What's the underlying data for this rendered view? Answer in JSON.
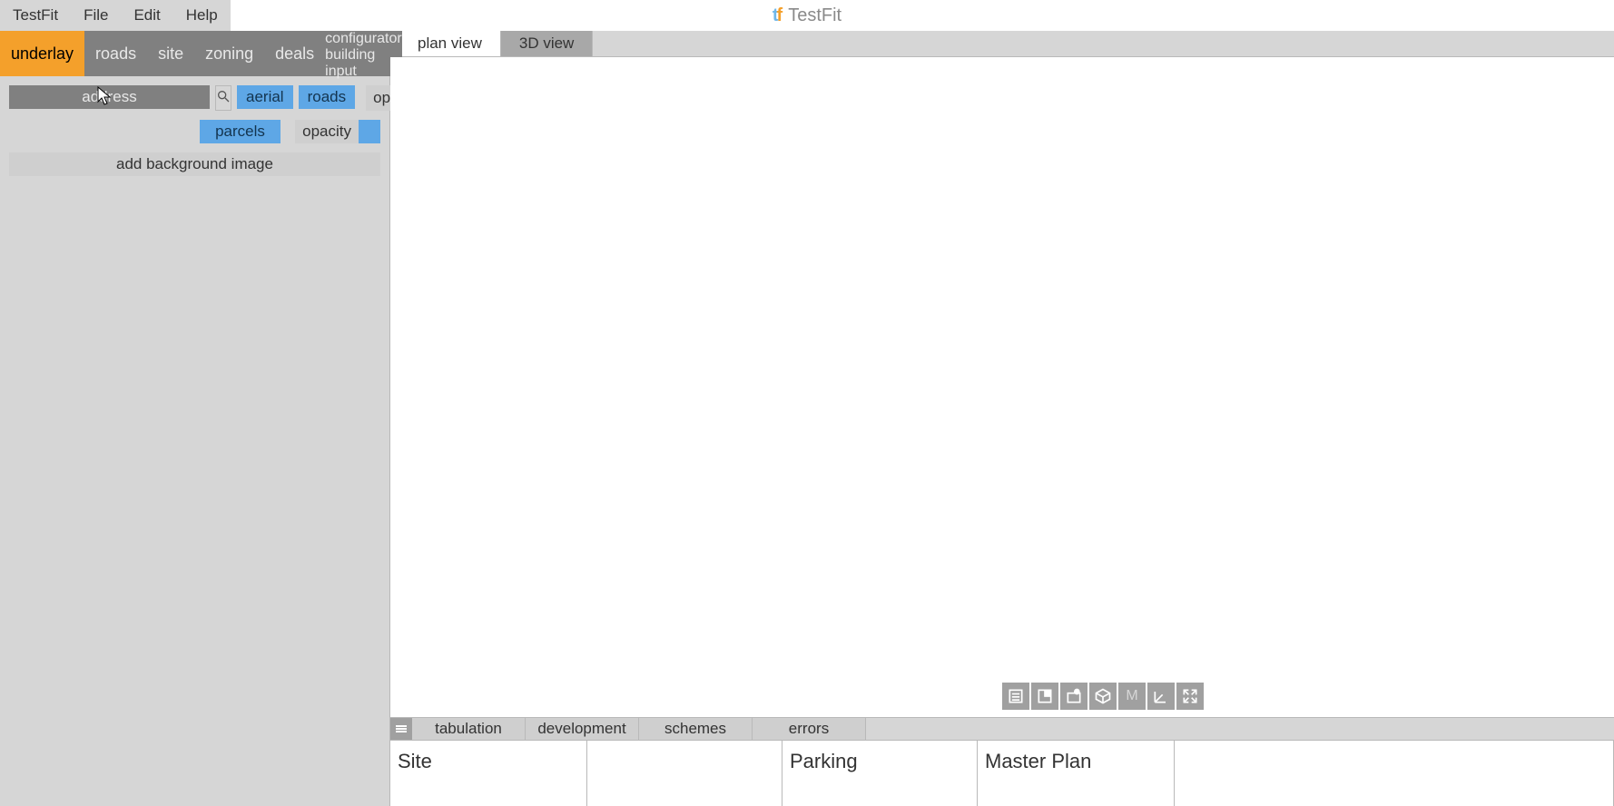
{
  "menu": {
    "app": "TestFit",
    "file": "File",
    "edit": "Edit",
    "help": "Help"
  },
  "titlebar": {
    "name": "TestFit"
  },
  "sidebar": {
    "tabs": {
      "underlay": "underlay",
      "roads": "roads",
      "site": "site",
      "zoning": "zoning",
      "deals": "deals"
    },
    "rightTabs": {
      "configurator": "configurator",
      "building_input": "building input"
    },
    "address_placeholder": "address",
    "chips": {
      "aerial": "aerial",
      "roads": "roads",
      "parcels": "parcels"
    },
    "opacity_label": "opacity",
    "add_bg": "add background image"
  },
  "viewport": {
    "plan": "plan view",
    "three_d": "3D view"
  },
  "tools": {
    "t1": "list-icon",
    "t2": "sheet-icon",
    "t3": "layer-dot-icon",
    "t4": "cube-icon",
    "t5": "M",
    "t6": "axes-icon",
    "t7": "expand-icon"
  },
  "bottom": {
    "tabs": {
      "tabulation": "tabulation",
      "development": "development",
      "schemes": "schemes",
      "errors": "errors"
    },
    "cols": {
      "site": "Site",
      "parking": "Parking",
      "master": "Master Plan"
    }
  }
}
